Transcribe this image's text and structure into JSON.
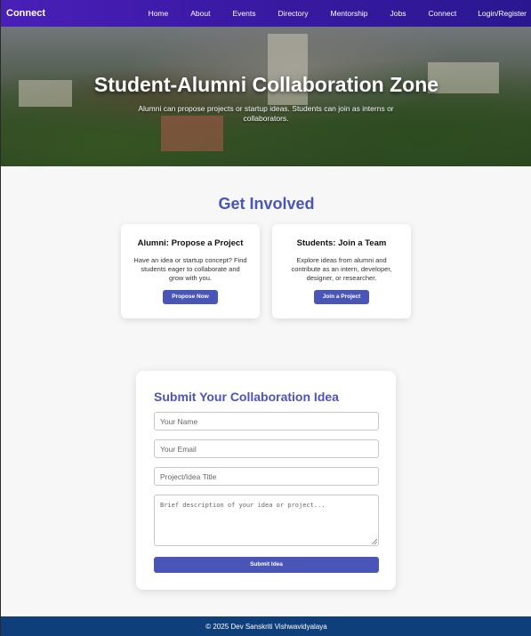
{
  "nav": {
    "brand": "Connect",
    "links": [
      "Home",
      "About",
      "Events",
      "Directory",
      "Mentorship",
      "Jobs",
      "Connect",
      "Login/Register"
    ]
  },
  "hero": {
    "title": "Student-Alumni Collaboration Zone",
    "subtitle": "Alumni can propose projects or startup ideas. Students can join as interns or collaborators."
  },
  "involved": {
    "title": "Get Involved",
    "cards": [
      {
        "title": "Alumni: Propose a Project",
        "text": "Have an idea or startup concept? Find students eager to collaborate and grow with you.",
        "button": "Propose Now"
      },
      {
        "title": "Students: Join a Team",
        "text": "Explore ideas from alumni and contribute as an intern, developer, designer, or researcher.",
        "button": "Join a Project"
      }
    ]
  },
  "form": {
    "title": "Submit Your Collaboration Idea",
    "name_placeholder": "Your Name",
    "email_placeholder": "Your Email",
    "project_placeholder": "Project/Idea Title",
    "description_placeholder": "Brief description of your idea or project...",
    "submit_label": "Submit Idea"
  },
  "footer": {
    "text": "© 2025 Dev Sanskriti Vishwavidyalaya"
  },
  "colors": {
    "nav": "#3b1aa6",
    "accent": "#4a55b8",
    "footer": "#0e3f7a"
  }
}
